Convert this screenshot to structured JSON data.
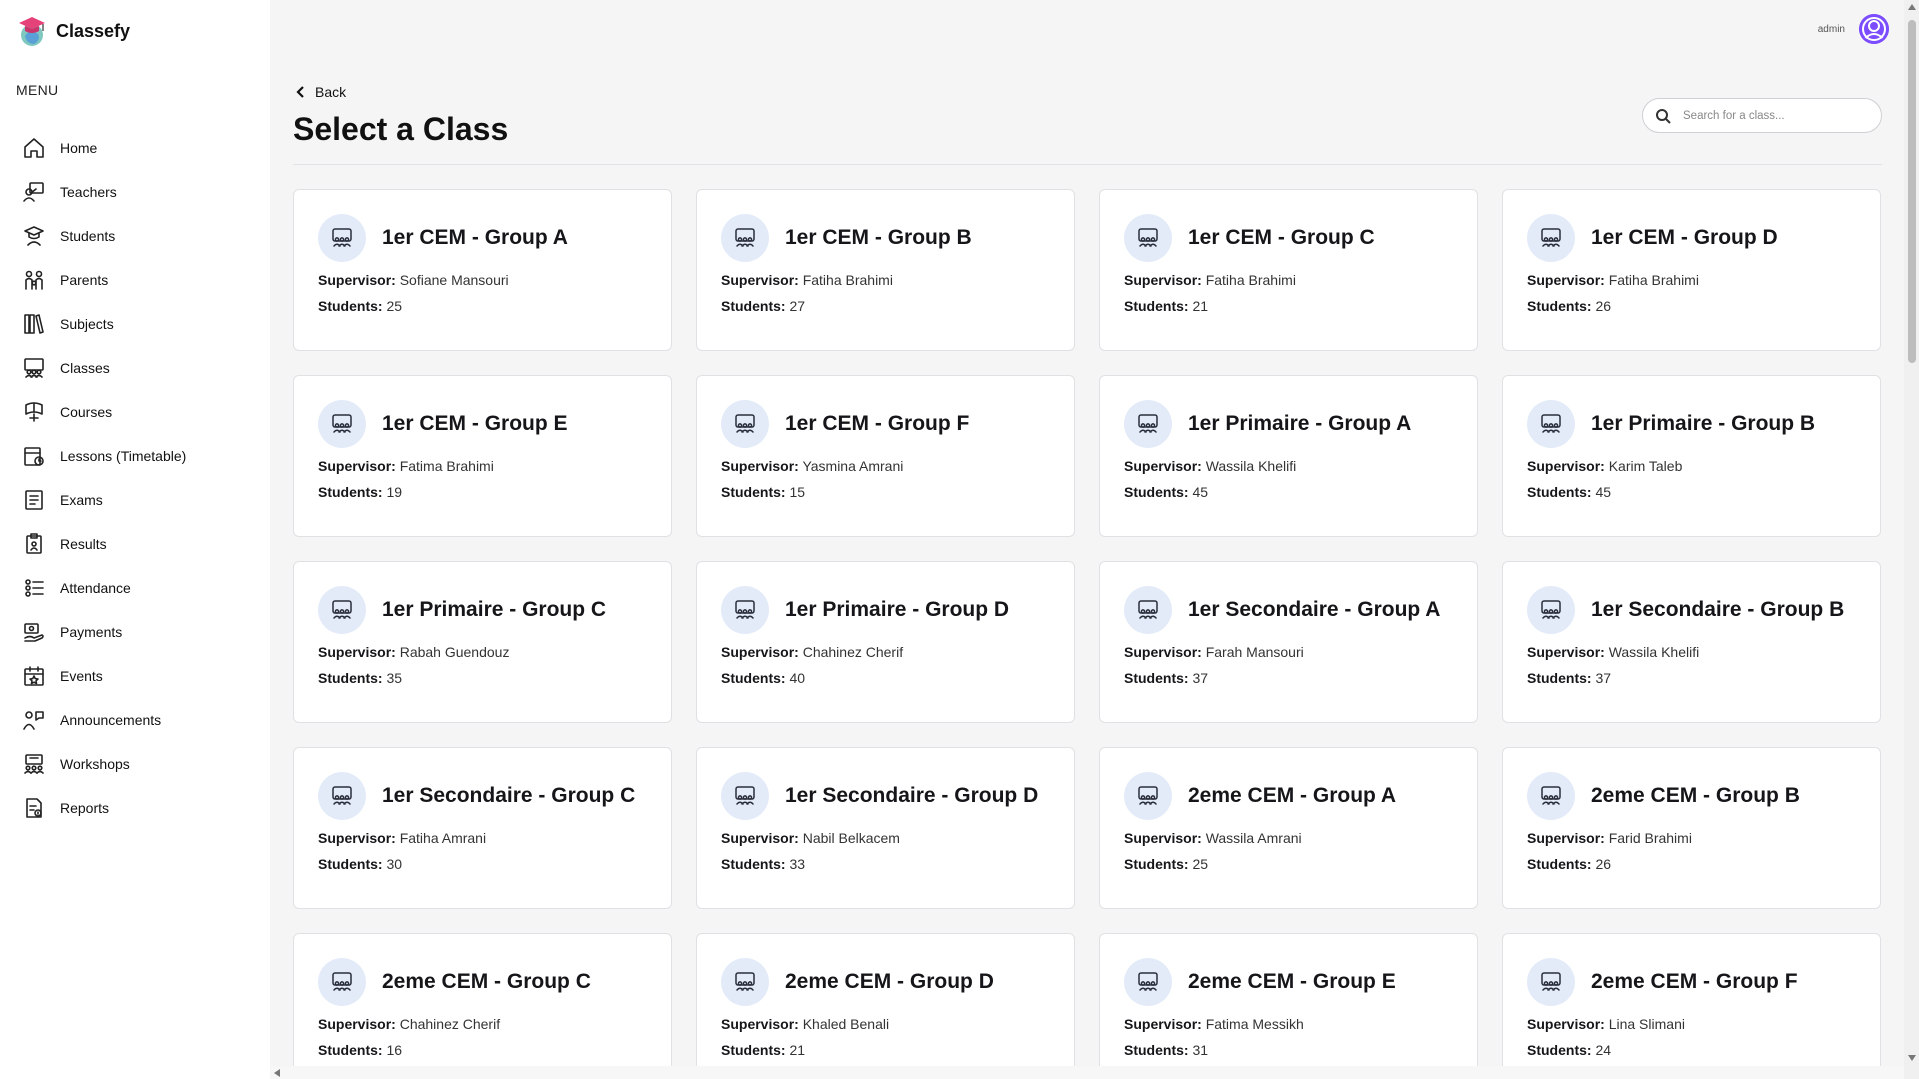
{
  "brand": {
    "name": "Classefy"
  },
  "sidebar": {
    "menu_title": "MENU",
    "items": [
      {
        "label": "Home",
        "icon": "home-icon"
      },
      {
        "label": "Teachers",
        "icon": "teacher-icon"
      },
      {
        "label": "Students",
        "icon": "student-icon"
      },
      {
        "label": "Parents",
        "icon": "parents-icon"
      },
      {
        "label": "Subjects",
        "icon": "books-icon"
      },
      {
        "label": "Classes",
        "icon": "classroom-icon"
      },
      {
        "label": "Courses",
        "icon": "course-icon"
      },
      {
        "label": "Lessons (Timetable)",
        "icon": "timetable-icon"
      },
      {
        "label": "Exams",
        "icon": "exam-icon"
      },
      {
        "label": "Results",
        "icon": "results-icon"
      },
      {
        "label": "Attendance",
        "icon": "attendance-icon"
      },
      {
        "label": "Payments",
        "icon": "payments-icon"
      },
      {
        "label": "Events",
        "icon": "events-icon"
      },
      {
        "label": "Announcements",
        "icon": "announcements-icon"
      },
      {
        "label": "Workshops",
        "icon": "workshops-icon"
      },
      {
        "label": "Reports",
        "icon": "reports-icon"
      }
    ]
  },
  "topbar": {
    "user": "admin",
    "avatar_color": "#7c4dff"
  },
  "main": {
    "back_label": "Back",
    "title": "Select a Class",
    "search_placeholder": "Search for a class...",
    "supervisor_label": "Supervisor:",
    "students_label": "Students:",
    "icon_bg": "#e3ebf9",
    "classes": [
      {
        "name": "1er CEM - Group A",
        "supervisor": "Sofiane Mansouri",
        "students": "25"
      },
      {
        "name": "1er CEM - Group B",
        "supervisor": "Fatiha Brahimi",
        "students": "27"
      },
      {
        "name": "1er CEM - Group C",
        "supervisor": "Fatiha Brahimi",
        "students": "21"
      },
      {
        "name": "1er CEM - Group D",
        "supervisor": "Fatiha Brahimi",
        "students": "26"
      },
      {
        "name": "1er CEM - Group E",
        "supervisor": "Fatima Brahimi",
        "students": "19"
      },
      {
        "name": "1er CEM - Group F",
        "supervisor": "Yasmina Amrani",
        "students": "15"
      },
      {
        "name": "1er Primaire - Group A",
        "supervisor": "Wassila Khelifi",
        "students": "45"
      },
      {
        "name": "1er Primaire - Group B",
        "supervisor": "Karim Taleb",
        "students": "45"
      },
      {
        "name": "1er Primaire - Group C",
        "supervisor": "Rabah Guendouz",
        "students": "35"
      },
      {
        "name": "1er Primaire - Group D",
        "supervisor": "Chahinez Cherif",
        "students": "40"
      },
      {
        "name": "1er Secondaire - Group A",
        "supervisor": "Farah Mansouri",
        "students": "37"
      },
      {
        "name": "1er Secondaire - Group B",
        "supervisor": "Wassila Khelifi",
        "students": "37"
      },
      {
        "name": "1er Secondaire - Group C",
        "supervisor": "Fatiha Amrani",
        "students": "30"
      },
      {
        "name": "1er Secondaire - Group D",
        "supervisor": "Nabil Belkacem",
        "students": "33"
      },
      {
        "name": "2eme CEM - Group A",
        "supervisor": "Wassila Amrani",
        "students": "25"
      },
      {
        "name": "2eme CEM - Group B",
        "supervisor": "Farid Brahimi",
        "students": "26"
      },
      {
        "name": "2eme CEM - Group C",
        "supervisor": "Chahinez Cherif",
        "students": "16"
      },
      {
        "name": "2eme CEM - Group D",
        "supervisor": "Khaled Benali",
        "students": "21"
      },
      {
        "name": "2eme CEM - Group E",
        "supervisor": "Fatima Messikh",
        "students": "31"
      },
      {
        "name": "2eme CEM - Group F",
        "supervisor": "Lina Slimani",
        "students": "24"
      }
    ]
  }
}
